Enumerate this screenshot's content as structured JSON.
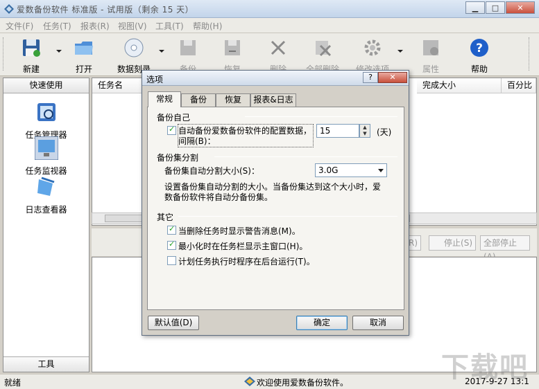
{
  "window": {
    "title": "爱数备份软件 标准版 - 试用版（剩余 15 天）",
    "controls": [
      "minimize",
      "maximize",
      "close"
    ]
  },
  "menu": [
    "文件(F)",
    "任务(T)",
    "报表(R)",
    "视图(V)",
    "工具(T)",
    "帮助(H)"
  ],
  "toolbar": {
    "buttons": [
      {
        "label": "新建",
        "icon": "new-disk-icon",
        "enabled": true
      },
      {
        "label": "打开",
        "icon": "folder-icon",
        "enabled": true
      },
      {
        "label": "数据刻录",
        "icon": "cd-icon",
        "enabled": true
      },
      {
        "label": "备份",
        "icon": "backup-icon",
        "enabled": false
      },
      {
        "label": "恢复",
        "icon": "restore-icon",
        "enabled": false
      },
      {
        "label": "删除",
        "icon": "delete-icon",
        "enabled": false
      },
      {
        "label": "全部删除",
        "icon": "delete-all-icon",
        "enabled": false
      },
      {
        "label": "修改选项",
        "icon": "options-icon",
        "enabled": false
      },
      {
        "label": "属性",
        "icon": "properties-icon",
        "enabled": false
      },
      {
        "label": "帮助",
        "icon": "help-icon",
        "enabled": true
      }
    ]
  },
  "quick": {
    "header": "快速使用",
    "items": [
      "任务管理器",
      "任务监视器",
      "日志查看器"
    ],
    "footer": "工具"
  },
  "list": {
    "columns": [
      "任务名",
      "完成大小",
      "百分比"
    ]
  },
  "controls": {
    "buttons": [
      "R)",
      "停止(S)",
      "全部停止(A)"
    ]
  },
  "status": {
    "left": "就绪",
    "message": "欢迎使用爱数备份软件。",
    "datetime": "2017-9-27  13:1"
  },
  "watermark": "下载吧",
  "dialog": {
    "title": "选项",
    "help": "?",
    "close": "✕",
    "tabs": [
      "常规",
      "备份",
      "恢复",
      "报表&日志"
    ],
    "active_tab": "常规",
    "groups": {
      "self_backup": {
        "label": "备份自己",
        "checkbox_line1": "自动备份爱数备份软件的配置数据，",
        "checkbox_line2": "间隔(B)：",
        "checked": true,
        "interval_value": "15",
        "interval_unit": "(天)"
      },
      "split": {
        "label": "备份集分割",
        "size_label": "备份集自动分割大小(S)：",
        "size_value": "3.0G",
        "description_line1": "设置备份集自动分割的大小。当备份集达到这个大小时，爱",
        "description_line2": "数备份软件将自动分备份集。"
      },
      "other": {
        "label": "其它",
        "options": [
          {
            "label": "当删除任务时显示警告消息(M)。",
            "checked": true
          },
          {
            "label": "最小化时在任务栏显示主窗口(H)。",
            "checked": true
          },
          {
            "label": "计划任务执行时程序在后台运行(T)。",
            "checked": false
          }
        ]
      }
    },
    "buttons": {
      "default": "默认值(D)",
      "ok": "确定",
      "cancel": "取消"
    }
  }
}
